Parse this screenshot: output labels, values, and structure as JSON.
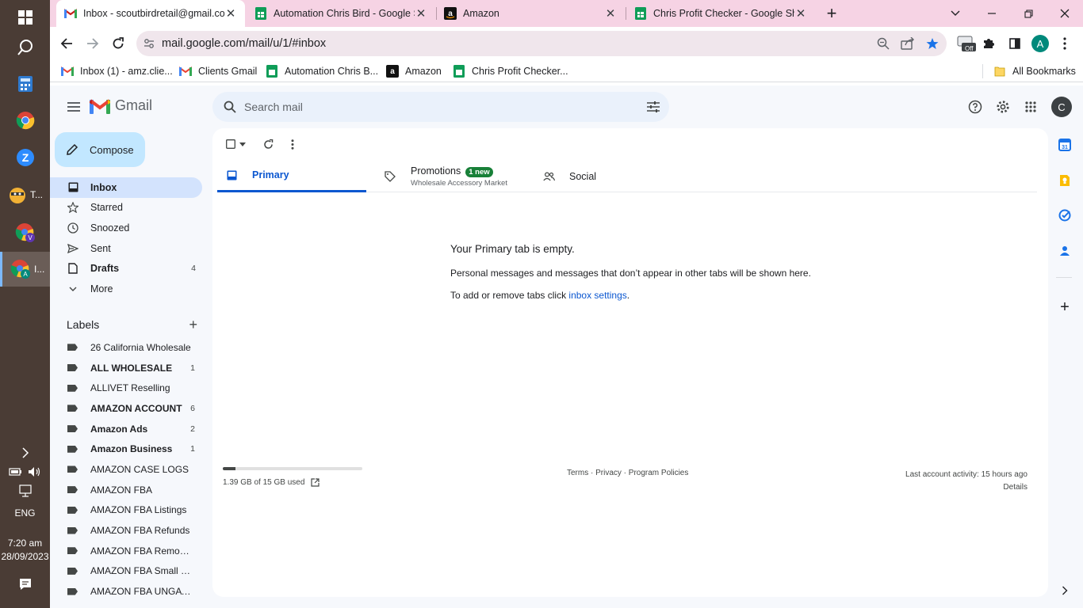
{
  "taskbar": {
    "items": [
      {
        "label": "T..."
      },
      {
        "label": "I..."
      }
    ],
    "language": "ENG",
    "time": "7:20 am",
    "date": "28/09/2023"
  },
  "browser": {
    "tabs": [
      {
        "title": "Inbox - scoutbirdretail@gmail.com",
        "icon": "gmail-icon"
      },
      {
        "title": "Automation Chris Bird - Google Sheets",
        "icon": "sheets-icon"
      },
      {
        "title": "Amazon",
        "icon": "amazon-icon"
      },
      {
        "title": "Chris Profit Checker - Google Sheets",
        "icon": "sheets-icon"
      }
    ],
    "url": "mail.google.com/mail/u/1/#inbox",
    "profile_initial": "A",
    "ext_badge": "Off",
    "bookmarks": [
      {
        "label": "Inbox (1) - amz.clie...",
        "icon": "gmail-icon"
      },
      {
        "label": "Clients Gmail",
        "icon": "gmail-icon"
      },
      {
        "label": "Automation Chris B...",
        "icon": "sheets-icon"
      },
      {
        "label": "Amazon",
        "icon": "amazon-icon"
      },
      {
        "label": "Chris Profit Checker...",
        "icon": "sheets-icon"
      }
    ],
    "all_bookmarks": "All Bookmarks"
  },
  "gmail": {
    "brand": "Gmail",
    "search_placeholder": "Search mail",
    "user_initial": "C",
    "compose": "Compose",
    "nav": [
      {
        "label": "Inbox",
        "count": ""
      },
      {
        "label": "Starred",
        "count": ""
      },
      {
        "label": "Snoozed",
        "count": ""
      },
      {
        "label": "Sent",
        "count": ""
      },
      {
        "label": "Drafts",
        "count": "4"
      },
      {
        "label": "More",
        "count": ""
      }
    ],
    "labels_title": "Labels",
    "labels": [
      {
        "name": "26 California Wholesale",
        "count": "",
        "bold": false
      },
      {
        "name": "ALL WHOLESALE",
        "count": "1",
        "bold": true
      },
      {
        "name": "ALLIVET Reselling",
        "count": "",
        "bold": false
      },
      {
        "name": "AMAZON ACCOUNT",
        "count": "6",
        "bold": true
      },
      {
        "name": "Amazon Ads",
        "count": "2",
        "bold": true
      },
      {
        "name": "Amazon Business",
        "count": "1",
        "bold": true
      },
      {
        "name": "AMAZON CASE LOGS",
        "count": "",
        "bold": false
      },
      {
        "name": "AMAZON FBA",
        "count": "",
        "bold": false
      },
      {
        "name": "AMAZON FBA Listings",
        "count": "",
        "bold": false
      },
      {
        "name": "AMAZON FBA Refunds",
        "count": "",
        "bold": false
      },
      {
        "name": "AMAZON FBA Removals",
        "count": "",
        "bold": false
      },
      {
        "name": "AMAZON FBA Small & Light",
        "count": "",
        "bold": false
      },
      {
        "name": "AMAZON FBA UNGATING",
        "count": "",
        "bold": false
      }
    ],
    "tabs": {
      "primary": "Primary",
      "promotions": "Promotions",
      "promotions_badge": "1 new",
      "promotions_sub": "Wholesale Accessory Market",
      "social": "Social"
    },
    "empty": {
      "title": "Your Primary tab is empty.",
      "line1": "Personal messages and messages that don’t appear in other tabs will be shown here.",
      "line2_prefix": "To add or remove tabs click ",
      "line2_link": "inbox settings",
      "line2_suffix": "."
    },
    "storage": {
      "text": "1.39 GB of 15 GB used",
      "fraction": 0.093
    },
    "footer": "Terms · Privacy · Program Policies",
    "activity": "Last account activity: 15 hours ago",
    "details": "Details"
  },
  "colors": {
    "tabstrip": "#f6d3e4",
    "accent": "#0b57d0",
    "compose": "#c2e7ff",
    "active_nav": "#d3e3fd",
    "badge": "#188038"
  }
}
